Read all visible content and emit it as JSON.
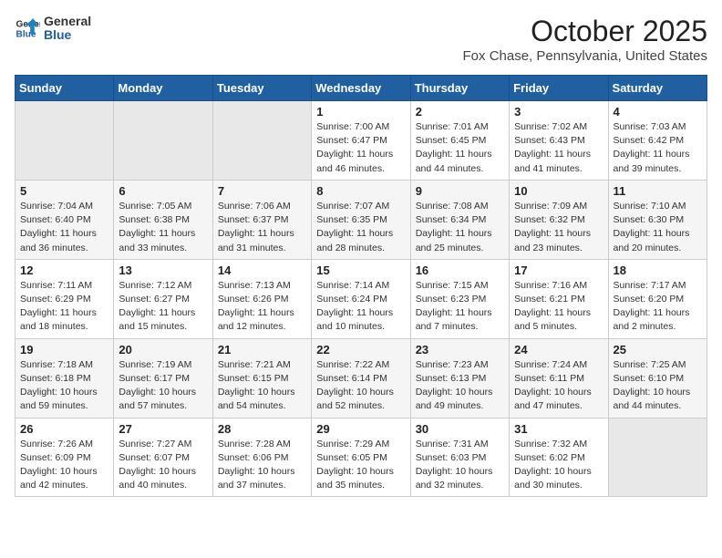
{
  "header": {
    "logo_general": "General",
    "logo_blue": "Blue",
    "month": "October 2025",
    "location": "Fox Chase, Pennsylvania, United States"
  },
  "days_of_week": [
    "Sunday",
    "Monday",
    "Tuesday",
    "Wednesday",
    "Thursday",
    "Friday",
    "Saturday"
  ],
  "weeks": [
    {
      "days": [
        {
          "num": "",
          "empty": true
        },
        {
          "num": "",
          "empty": true
        },
        {
          "num": "",
          "empty": true
        },
        {
          "num": "1",
          "sunrise": "7:00 AM",
          "sunset": "6:47 PM",
          "daylight": "11 hours and 46 minutes."
        },
        {
          "num": "2",
          "sunrise": "7:01 AM",
          "sunset": "6:45 PM",
          "daylight": "11 hours and 44 minutes."
        },
        {
          "num": "3",
          "sunrise": "7:02 AM",
          "sunset": "6:43 PM",
          "daylight": "11 hours and 41 minutes."
        },
        {
          "num": "4",
          "sunrise": "7:03 AM",
          "sunset": "6:42 PM",
          "daylight": "11 hours and 39 minutes."
        }
      ]
    },
    {
      "days": [
        {
          "num": "5",
          "sunrise": "7:04 AM",
          "sunset": "6:40 PM",
          "daylight": "11 hours and 36 minutes."
        },
        {
          "num": "6",
          "sunrise": "7:05 AM",
          "sunset": "6:38 PM",
          "daylight": "11 hours and 33 minutes."
        },
        {
          "num": "7",
          "sunrise": "7:06 AM",
          "sunset": "6:37 PM",
          "daylight": "11 hours and 31 minutes."
        },
        {
          "num": "8",
          "sunrise": "7:07 AM",
          "sunset": "6:35 PM",
          "daylight": "11 hours and 28 minutes."
        },
        {
          "num": "9",
          "sunrise": "7:08 AM",
          "sunset": "6:34 PM",
          "daylight": "11 hours and 25 minutes."
        },
        {
          "num": "10",
          "sunrise": "7:09 AM",
          "sunset": "6:32 PM",
          "daylight": "11 hours and 23 minutes."
        },
        {
          "num": "11",
          "sunrise": "7:10 AM",
          "sunset": "6:30 PM",
          "daylight": "11 hours and 20 minutes."
        }
      ]
    },
    {
      "days": [
        {
          "num": "12",
          "sunrise": "7:11 AM",
          "sunset": "6:29 PM",
          "daylight": "11 hours and 18 minutes."
        },
        {
          "num": "13",
          "sunrise": "7:12 AM",
          "sunset": "6:27 PM",
          "daylight": "11 hours and 15 minutes."
        },
        {
          "num": "14",
          "sunrise": "7:13 AM",
          "sunset": "6:26 PM",
          "daylight": "11 hours and 12 minutes."
        },
        {
          "num": "15",
          "sunrise": "7:14 AM",
          "sunset": "6:24 PM",
          "daylight": "11 hours and 10 minutes."
        },
        {
          "num": "16",
          "sunrise": "7:15 AM",
          "sunset": "6:23 PM",
          "daylight": "11 hours and 7 minutes."
        },
        {
          "num": "17",
          "sunrise": "7:16 AM",
          "sunset": "6:21 PM",
          "daylight": "11 hours and 5 minutes."
        },
        {
          "num": "18",
          "sunrise": "7:17 AM",
          "sunset": "6:20 PM",
          "daylight": "11 hours and 2 minutes."
        }
      ]
    },
    {
      "days": [
        {
          "num": "19",
          "sunrise": "7:18 AM",
          "sunset": "6:18 PM",
          "daylight": "10 hours and 59 minutes."
        },
        {
          "num": "20",
          "sunrise": "7:19 AM",
          "sunset": "6:17 PM",
          "daylight": "10 hours and 57 minutes."
        },
        {
          "num": "21",
          "sunrise": "7:21 AM",
          "sunset": "6:15 PM",
          "daylight": "10 hours and 54 minutes."
        },
        {
          "num": "22",
          "sunrise": "7:22 AM",
          "sunset": "6:14 PM",
          "daylight": "10 hours and 52 minutes."
        },
        {
          "num": "23",
          "sunrise": "7:23 AM",
          "sunset": "6:13 PM",
          "daylight": "10 hours and 49 minutes."
        },
        {
          "num": "24",
          "sunrise": "7:24 AM",
          "sunset": "6:11 PM",
          "daylight": "10 hours and 47 minutes."
        },
        {
          "num": "25",
          "sunrise": "7:25 AM",
          "sunset": "6:10 PM",
          "daylight": "10 hours and 44 minutes."
        }
      ]
    },
    {
      "days": [
        {
          "num": "26",
          "sunrise": "7:26 AM",
          "sunset": "6:09 PM",
          "daylight": "10 hours and 42 minutes."
        },
        {
          "num": "27",
          "sunrise": "7:27 AM",
          "sunset": "6:07 PM",
          "daylight": "10 hours and 40 minutes."
        },
        {
          "num": "28",
          "sunrise": "7:28 AM",
          "sunset": "6:06 PM",
          "daylight": "10 hours and 37 minutes."
        },
        {
          "num": "29",
          "sunrise": "7:29 AM",
          "sunset": "6:05 PM",
          "daylight": "10 hours and 35 minutes."
        },
        {
          "num": "30",
          "sunrise": "7:31 AM",
          "sunset": "6:03 PM",
          "daylight": "10 hours and 32 minutes."
        },
        {
          "num": "31",
          "sunrise": "7:32 AM",
          "sunset": "6:02 PM",
          "daylight": "10 hours and 30 minutes."
        },
        {
          "num": "",
          "empty": true
        }
      ]
    }
  ]
}
